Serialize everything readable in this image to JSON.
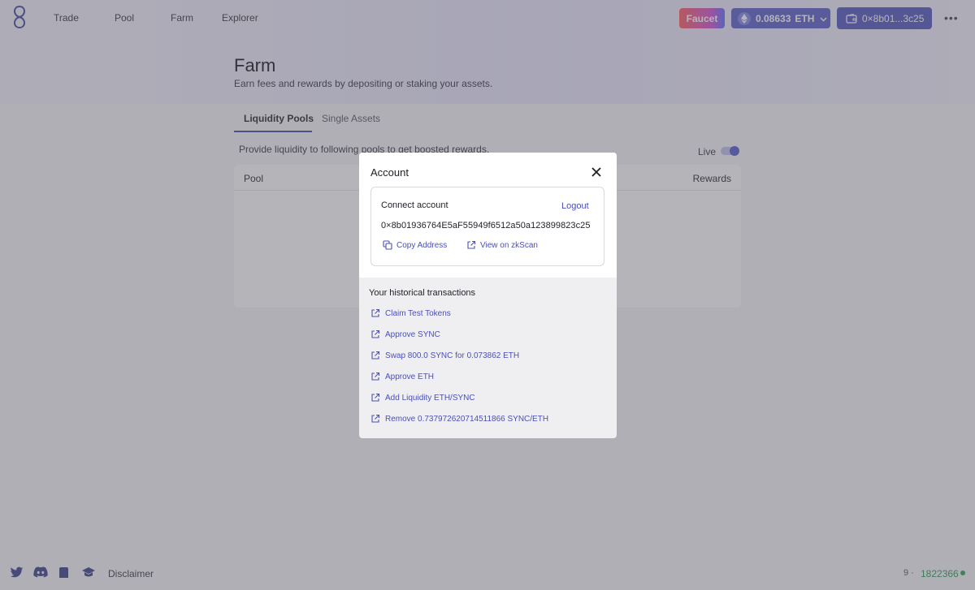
{
  "nav": {
    "links": [
      "Trade",
      "Pool",
      "Farm",
      "Explorer"
    ],
    "faucet_label": "Faucet",
    "eth_balance": "0.08633",
    "eth_unit": "ETH",
    "account_short": "0×8b01...3c25"
  },
  "page": {
    "title": "Farm",
    "subtitle": "Earn fees and rewards by depositing or staking your assets.",
    "tabs": [
      "Liquidity Pools",
      "Single Assets"
    ],
    "provide_text": "Provide liquidity to following pools to get boosted rewards.",
    "live_label": "Live",
    "table_headers": {
      "pool": "Pool",
      "rewards": "Rewards"
    }
  },
  "footer": {
    "disclaimer": "Disclaimer",
    "block_prefix": "9 ·",
    "block_number": "1822366"
  },
  "modal": {
    "title": "Account",
    "connect_label": "Connect account",
    "logout_label": "Logout",
    "address": "0×8b01936764E5aF55949f6512a50a123899823c25",
    "copy_label": "Copy Address",
    "zkscan_label": "View on zkScan",
    "history_title": "Your historical transactions",
    "transactions": [
      "Claim Test Tokens",
      "Approve SYNC",
      "Swap 800.0 SYNC for 0.073862 ETH",
      "Approve ETH",
      "Add Liquidity ETH/SYNC",
      "Remove 0.737972620714511866 SYNC/ETH"
    ]
  },
  "colors": {
    "accent": "#4b4fb7",
    "button": "#5a5cc8",
    "live_green": "#2aa05a"
  }
}
